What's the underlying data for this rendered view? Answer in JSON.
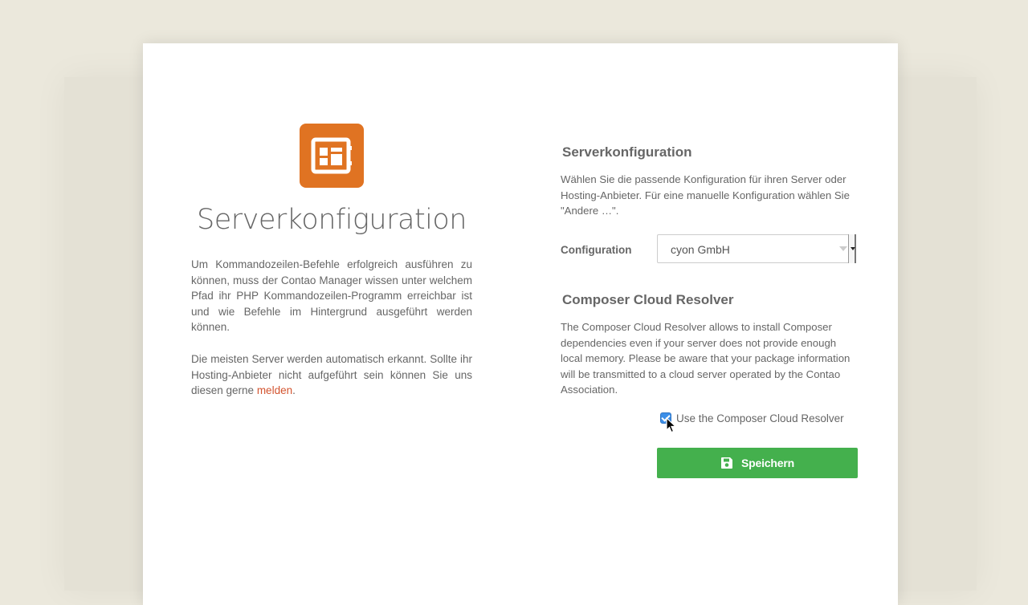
{
  "left": {
    "title": "Serverkonfiguration",
    "paragraph1": "Um Kommandozeilen-Befehle erfolgreich ausführen zu können, muss der Contao Manager wissen unter welchem Pfad ihr PHP Kommandozeilen-Programm erreichbar ist und wie Befehle im Hintergrund ausgeführt werden können.",
    "paragraph2_text": "Die meisten Server werden automatisch erkannt. Sollte ihr Hosting-Anbieter nicht aufgeführt sein können Sie uns diesen gerne ",
    "paragraph2_link": "melden",
    "paragraph2_end": "."
  },
  "server_config": {
    "title": "Serverkonfiguration",
    "description": "Wählen Sie die passende Konfiguration für ihren Server oder Hosting-Anbieter. Für eine manuelle Konfiguration wählen Sie \"Andere …\".",
    "label": "Configuration",
    "selected": "cyon GmbH"
  },
  "cloud_resolver": {
    "title": "Composer Cloud Resolver",
    "description": "The Composer Cloud Resolver allows to install Composer dependencies even if your server does not provide enough local memory. Please be aware that your package information will be transmitted to a cloud server operated by the Contao Association.",
    "checkbox_label": "Use the Composer Cloud Resolver",
    "checked": true
  },
  "save_button": {
    "label": "Speichern",
    "icon": "save-icon"
  },
  "colors": {
    "background": "#ebe8dc",
    "logo": "#e07322",
    "link": "#d3542f",
    "save": "#44b04d",
    "checkbox": "#3b8ee8"
  }
}
